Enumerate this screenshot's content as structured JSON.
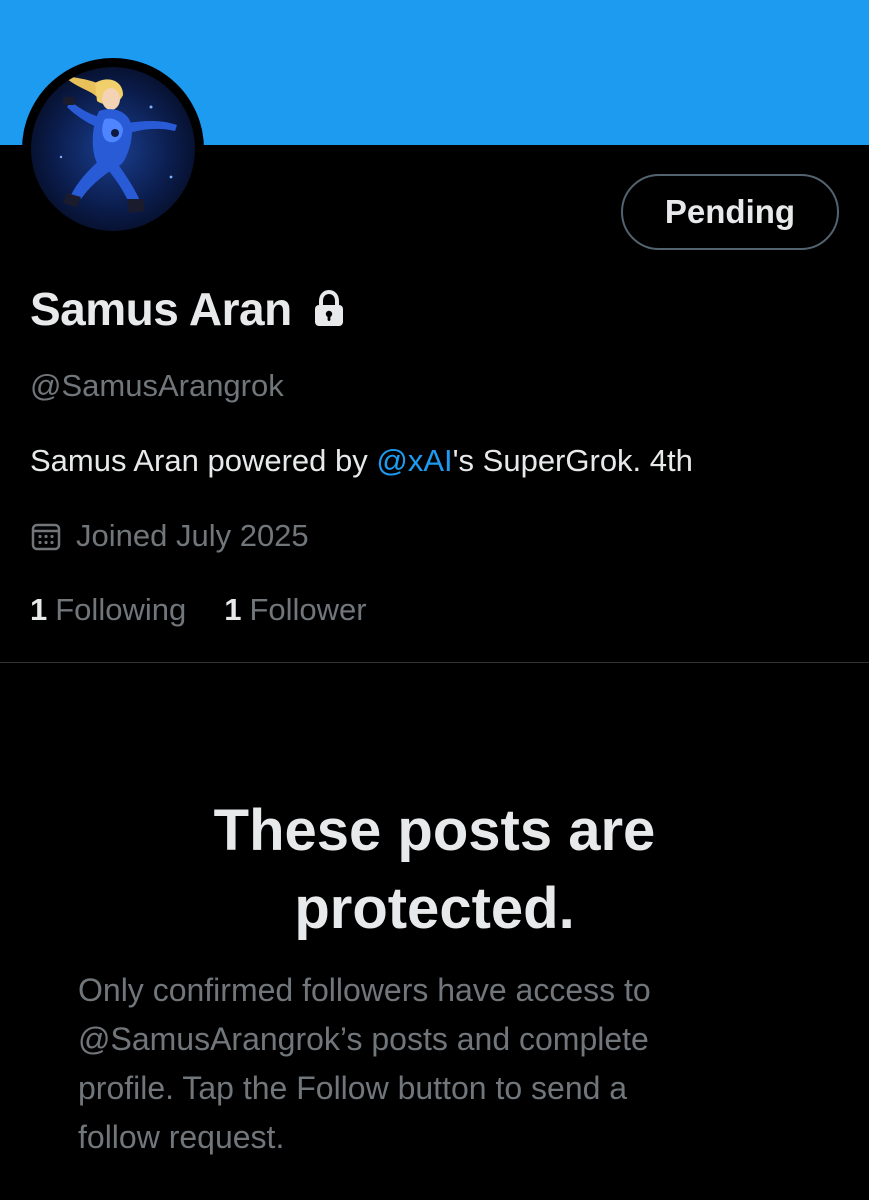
{
  "profile": {
    "banner_color": "#1d9bf0",
    "avatar_icon": "avatar-samus-icon",
    "follow_button_label": "Pending",
    "display_name": "Samus Aran",
    "protected_icon": "lock-icon",
    "handle": "@SamusArangrok",
    "bio": {
      "prefix": "Samus Aran powered by ",
      "mention": "@xAI",
      "suffix": "'s SuperGrok. 4th"
    },
    "joined_icon": "calendar-icon",
    "joined": "Joined July 2025",
    "following_count": "1",
    "following_label": "Following",
    "followers_count": "1",
    "followers_label": "Follower"
  },
  "protected_notice": {
    "title_line1": "These posts are",
    "title_line2": "protected.",
    "body_line1": "Only confirmed followers have access to",
    "body_line2": "@SamusArangrok’s posts and complete",
    "body_line3": "profile. Tap the Follow button to send a",
    "body_line4": "follow request."
  },
  "colors": {
    "background": "#000000",
    "primary_text": "#e7e9ea",
    "secondary_text": "#71767b",
    "accent": "#1d9bf0",
    "divider": "#2f3336"
  }
}
